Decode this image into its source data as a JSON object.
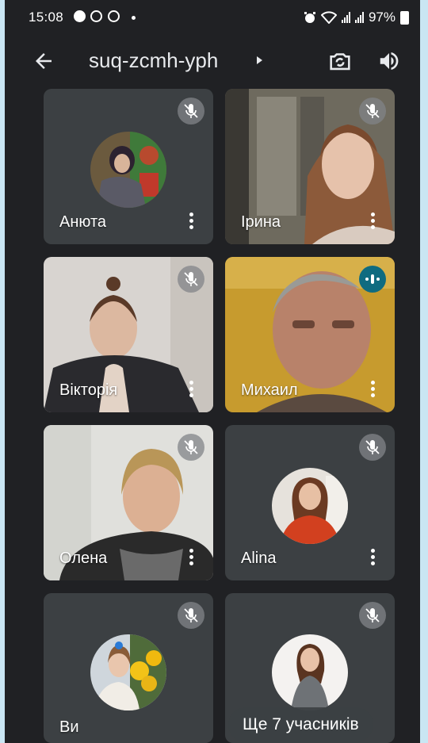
{
  "status_bar": {
    "time": "15:08",
    "battery": "97%"
  },
  "header": {
    "meeting_code": "suq-zcmh-yph"
  },
  "participants": [
    {
      "name": "Анюта",
      "muted": true,
      "view": "avatar"
    },
    {
      "name": "Ірина",
      "muted": true,
      "view": "video"
    },
    {
      "name": "Вікторія",
      "muted": true,
      "view": "video"
    },
    {
      "name": "Михаил",
      "muted": false,
      "speaking": true,
      "view": "video"
    },
    {
      "name": "Олена",
      "muted": false,
      "view": "video"
    },
    {
      "name": "Alina",
      "muted": true,
      "view": "avatar"
    },
    {
      "name": "Ви",
      "muted": true,
      "view": "avatar"
    },
    {
      "name": "",
      "muted": true,
      "view": "avatar"
    }
  ],
  "more_participants_label": "Ще 7 учасників",
  "icons": {
    "back": "arrow-left-icon",
    "switch_camera": "camera-switch-icon",
    "speaker": "speaker-icon",
    "muted": "mic-off-icon",
    "speaking": "audio-level-icon",
    "menu": "more-vert-icon"
  },
  "colors": {
    "background": "#202124",
    "tile": "#3c4043",
    "speaking_badge": "#0f6b80"
  }
}
